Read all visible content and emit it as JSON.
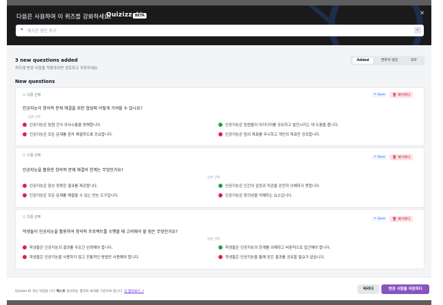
{
  "header": {
    "title": "다음은 사용하여 이 퀴즈를 강화하세요.",
    "brand": "Quizizz",
    "brand_ai": "AI",
    "beta": "BETA",
    "close": "×"
  },
  "prompt": {
    "placeholder": "메소운 명운 추가"
  },
  "summary": {
    "title": "3 new questions added",
    "subtitle": "퀴즈에 변경 사항을 적용하려면 검토하고 저장하세요.",
    "tabs": [
      "Added",
      "변하지 않은",
      "모두"
    ],
    "active_tab": "Added"
  },
  "section_title": "New questions",
  "questions": [
    {
      "type": "다중 선택",
      "text": "인공지능이 창의적 문제 해결을 위한 협업에 어떻게 기여할 수 있나요?",
      "options_label": "답변 선택",
      "save": "Save",
      "delete": "제거하다",
      "options": [
        {
          "text": "인공지능은 팀원 간의 의사소통을 방해합니다.",
          "correct": false
        },
        {
          "text": "인공지능은 팀원들이 아이디어를 공유하고 발전시키는 데 도움을 줍니다.",
          "correct": true
        },
        {
          "text": "인공지능은 모든 문제를 혼자 해결하도록 강요합니다.",
          "correct": false
        },
        {
          "text": "인공지능은 팀의 목표를 무시하고 개인의 목표만 강조합니다.",
          "correct": false
        }
      ]
    },
    {
      "type": "다중 선택",
      "text": "인공지능을 활용한 창의적 문제 해결의 한계는 무엇인가요?",
      "options_label": "답변 선택",
      "save": "Save",
      "delete": "제거하다",
      "options": [
        {
          "text": "인공지능은 항상 정확한 결과를 제공합니다.",
          "correct": false
        },
        {
          "text": "인공지능은 인간의 감정과 직관을 완전히 이해하지 못합니다.",
          "correct": true
        },
        {
          "text": "인공지능은 모든 문제를 해결할 수 있는 만능 도구입니다.",
          "correct": false
        },
        {
          "text": "인공지능은 창의성을 저해하는 요소입니다.",
          "correct": false
        }
      ]
    },
    {
      "type": "다중 선택",
      "text": "학생들이 인공지능을 활용하여 창의적 프로젝트를 수행할 때 고려해야 할 점은 무엇인가요?",
      "options_label": "답변 선택",
      "save": "Save",
      "delete": "제거하다",
      "options": [
        {
          "text": "학생들은 인공지능의 결과를 무조건 신뢰해야 합니다.",
          "correct": false
        },
        {
          "text": "학생들은 인공지능의 한계를 이해하고 비판적으로 접근해야 합니다.",
          "correct": true
        },
        {
          "text": "학생들은 인공지능을 사용하지 않고 전통적인 방법만 사용해야 합니다.",
          "correct": false
        },
        {
          "text": "학생들은 인공지능을 통해 얻은 결과를 공유할 필요가 없습니다.",
          "correct": false
        }
      ]
    }
  ],
  "footer": {
    "note_prefix": "Quizizz AI 개선 작업을 니다",
    "note_bold": "텍스트",
    "note_mid": "생성되는 결과와 세대를 기반으로 합니다.",
    "note_link": "더 알아보기 ↗",
    "discard": "버리다",
    "save": "변경 사항을 저장하다"
  },
  "colors": {
    "accent": "#8854c0",
    "correct": "#16a34a",
    "incorrect": "#e11d48",
    "header_bg": "#1a1a1d"
  }
}
